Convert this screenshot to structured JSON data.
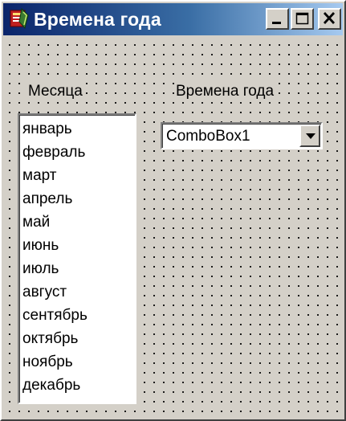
{
  "window": {
    "title": "Времена года",
    "controls": {
      "minimize_icon": "minimize-icon",
      "maximize_icon": "maximize-icon",
      "close_icon": "close-icon"
    }
  },
  "form": {
    "months_label": "Месяца",
    "seasons_label": "Времена года",
    "months_list": {
      "items": [
        "январь",
        "февраль",
        "март",
        "апрель",
        "май",
        "июнь",
        "июль",
        "август",
        "сентябрь",
        "октябрь",
        "ноябрь",
        "декабрь"
      ]
    },
    "combobox": {
      "value": "ComboBox1",
      "dropdown_icon": "dropdown-arrow-icon"
    }
  },
  "colors": {
    "window_face": "#d4d0c8",
    "titlebar_start": "#0a246a",
    "titlebar_end": "#a6caf0",
    "title_text": "#ffffff",
    "field_background": "#ffffff"
  }
}
